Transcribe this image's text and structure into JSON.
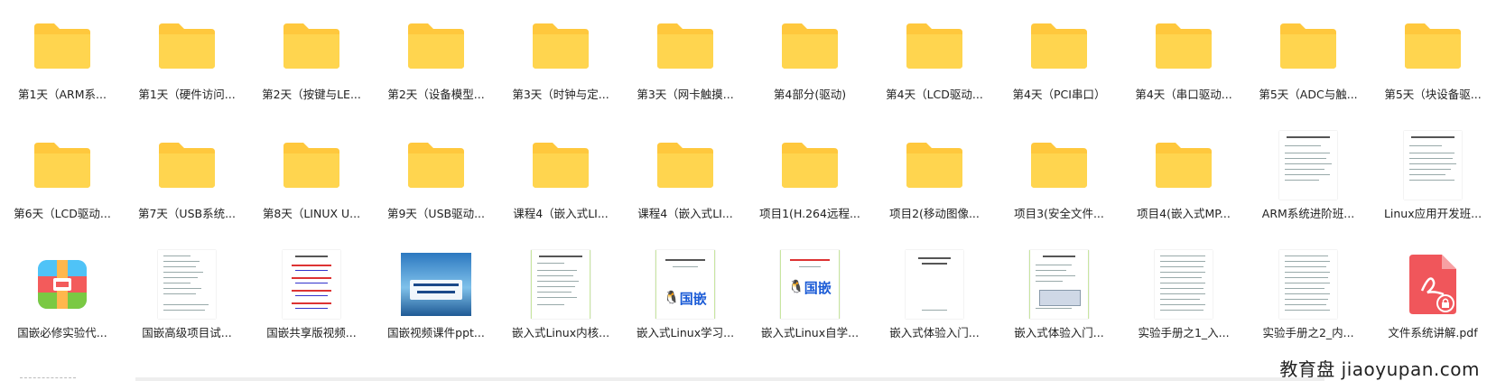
{
  "files": [
    {
      "type": "folder",
      "label": "第1天（ARM系..."
    },
    {
      "type": "folder",
      "label": "第1天（硬件访问..."
    },
    {
      "type": "folder",
      "label": "第2天（按键与LE..."
    },
    {
      "type": "folder",
      "label": "第2天（设备模型..."
    },
    {
      "type": "folder",
      "label": "第3天（时钟与定..."
    },
    {
      "type": "folder",
      "label": "第3天（网卡触摸..."
    },
    {
      "type": "folder",
      "label": "第4部分(驱动)"
    },
    {
      "type": "folder",
      "label": "第4天（LCD驱动..."
    },
    {
      "type": "folder",
      "label": "第4天（PCI串口）"
    },
    {
      "type": "folder",
      "label": "第4天（串口驱动..."
    },
    {
      "type": "folder",
      "label": "第5天（ADC与触..."
    },
    {
      "type": "folder",
      "label": "第5天（块设备驱..."
    },
    {
      "type": "folder",
      "label": "第6天（LCD驱动..."
    },
    {
      "type": "folder",
      "label": "第7天（USB系统..."
    },
    {
      "type": "folder",
      "label": "第8天（LINUX U..."
    },
    {
      "type": "folder",
      "label": "第9天（USB驱动..."
    },
    {
      "type": "folder",
      "label": "课程4（嵌入式LI..."
    },
    {
      "type": "folder",
      "label": "课程4（嵌入式LI..."
    },
    {
      "type": "folder",
      "label": "项目1(H.264远程..."
    },
    {
      "type": "folder",
      "label": "项目2(移动图像..."
    },
    {
      "type": "folder",
      "label": "项目3(安全文件..."
    },
    {
      "type": "folder",
      "label": "项目4(嵌入式MP..."
    },
    {
      "type": "doc",
      "label": "ARM系统进阶班..."
    },
    {
      "type": "doc",
      "label": "Linux应用开发班..."
    },
    {
      "type": "app",
      "label": "国嵌必修实验代..."
    },
    {
      "type": "doc",
      "label": "国嵌高级项目试..."
    },
    {
      "type": "doc",
      "label": "国嵌共享版视频..."
    },
    {
      "type": "slide",
      "label": "国嵌视频课件ppt..."
    },
    {
      "type": "doc",
      "label": "嵌入式Linux内核..."
    },
    {
      "type": "doc",
      "label": "嵌入式Linux学习..."
    },
    {
      "type": "doc",
      "label": "嵌入式Linux自学..."
    },
    {
      "type": "doc",
      "label": "嵌入式体验入门..."
    },
    {
      "type": "doc",
      "label": "嵌入式体验入门..."
    },
    {
      "type": "doc",
      "label": "实验手册之1_入..."
    },
    {
      "type": "doc",
      "label": "实验手册之2_内..."
    },
    {
      "type": "pdf",
      "label": "文件系统讲解.pdf"
    }
  ],
  "thumb_text": {
    "guoqian": "国嵌"
  },
  "watermark": "教育盘 jiaoyupan.com",
  "colors": {
    "folder": "#FFD54F",
    "folder_tab": "#FFC83D",
    "pdf": "#F0565B"
  }
}
